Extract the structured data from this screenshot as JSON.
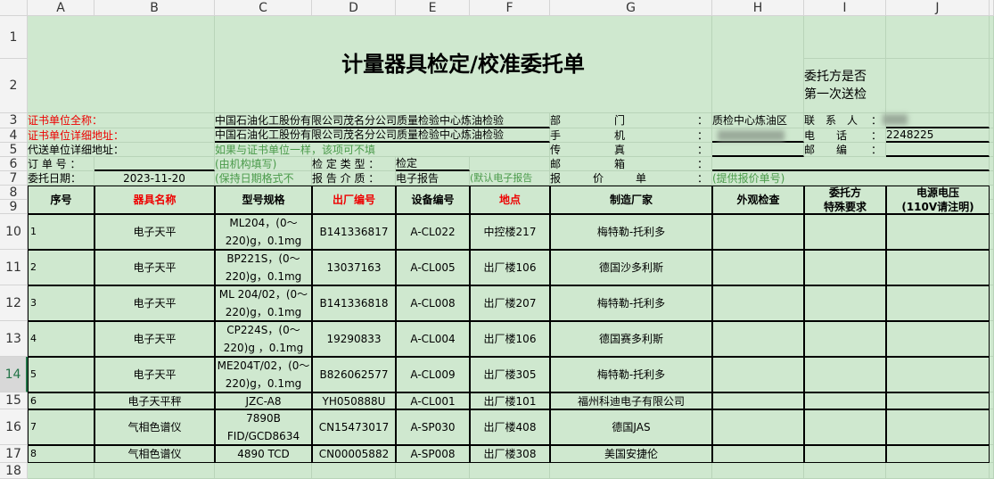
{
  "columns": [
    "A",
    "B",
    "C",
    "D",
    "E",
    "F",
    "G",
    "H",
    "I",
    "J"
  ],
  "rows": [
    "1",
    "2",
    "3",
    "4",
    "5",
    "6",
    "7",
    "8",
    "9",
    "10",
    "11",
    "12",
    "13",
    "14",
    "15",
    "16",
    "17",
    "18"
  ],
  "selected_row": "14",
  "title": "计量器具检定/校准委托单",
  "first_time_label": "委托方是否\n第一次送检",
  "form": {
    "cert_name_label": "证书单位全称：",
    "cert_name": "中国石油化工股份有限公司茂名分公司质量检验中心炼油检验",
    "cert_addr_label": "证书单位详细地址：",
    "cert_addr": "中国石油化工股份有限公司茂名分公司质量检验中心炼油检验",
    "proxy_addr_label": "代送单位详细地址：",
    "proxy_addr_hint": "如果与证书单位一样，该项可不填",
    "order_label": "订 单 号 ：",
    "order_hint": "(由机构填写)",
    "type_label": "检 定 类 型 ：",
    "type_value": "检定",
    "date_label": "委托日期：",
    "date_value": "2023-11-20",
    "date_hint": "(保持日期格式不",
    "medium_label": "报 告 介 质 ：",
    "medium_value": "电子报告",
    "medium_hint": "(默认电子报告",
    "dept_label": "部　　　　　门",
    "dept_value": "质检中心炼油区",
    "mobile_label": "手　　　　　机",
    "fax_label": "传　　　　　真",
    "email_label": "邮　　　　　箱",
    "quote_label": "报　　　价　　　单",
    "quote_hint": "(提供报价单号)",
    "colon": "：",
    "contact_label": "联　系　人",
    "phone_label": "电　　话",
    "phone_value": "2248225",
    "zip_label": "邮　　编"
  },
  "table": {
    "headers": [
      "序号",
      "器具名称",
      "型号规格",
      "出厂编号",
      "设备编号",
      "地点",
      "制造厂家",
      "外观检查",
      "委托方\n特殊要求",
      "电源电压\n(110V请注明)"
    ],
    "rows": [
      [
        "1",
        "电子天平",
        "ML204，(0～\n220)g，0.1mg",
        "B141336817",
        "A-CL022",
        "中控楼217",
        "梅特勒-托利多"
      ],
      [
        "2",
        "电子天平",
        "BP221S，(0～\n220)g，0.1mg",
        "13037163",
        "A-CL005",
        "出厂楼106",
        "德国沙多利斯"
      ],
      [
        "3",
        "电子天平",
        "ML 204/02，(0～\n220)g，0.1mg",
        "B141336818",
        "A-CL008",
        "出厂楼207",
        "梅特勒-托利多"
      ],
      [
        "4",
        "电子天平",
        "CP224S，(0～\n220)g ，0.1mg",
        "19290833",
        "A-CL004",
        "出厂楼106",
        "德国赛多利斯"
      ],
      [
        "5",
        "电子天平",
        "ME204T/02，(0～\n220)g，0.1mg",
        "B826062577",
        "A-CL009",
        "出厂楼305",
        "梅特勒-托利多"
      ],
      [
        "6",
        "电子天平秤",
        "JZC-A8",
        "YH050888U",
        "A-CL001",
        "出厂楼101",
        "福州科迪电子有限公司"
      ],
      [
        "7",
        "气相色谱仪",
        "7890B\nFID/GCD8634",
        "CN15473017",
        "A-SP030",
        "出厂楼408",
        "德国JAS"
      ],
      [
        "8",
        "气相色谱仪",
        "4890 TCD",
        "CN00005882",
        "A-SP008",
        "出厂楼308",
        "美国安捷伦"
      ]
    ]
  }
}
